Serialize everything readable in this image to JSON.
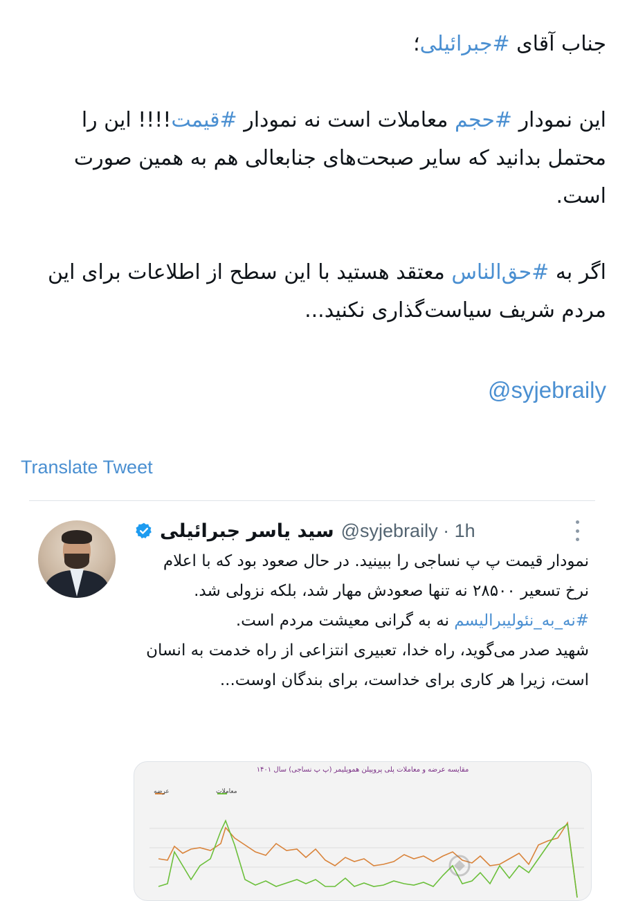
{
  "tweet": {
    "line1_pre": "جناب آقای ",
    "tag_jebraily": "#جبرائیلی",
    "line1_post": "؛",
    "para2_pre": "این نمودار ",
    "tag_hajm": "#حجم",
    "para2_mid": " معاملات است نه نمودار ",
    "tag_gheymat": "#قیمت",
    "para2_post": "!!!! این را محتمل بدانید که سایر صبحت‌های جنابعالی هم به همین صورت است.",
    "para3_pre": "اگر به ",
    "tag_haghonnas": "#حق‌الناس",
    "para3_post": " معتقد هستید با این سطح از اطلاعات برای این مردم شریف سیاست‌گذاری نکنید...",
    "mention": "@syjebraily"
  },
  "translate_label": "Translate Tweet",
  "quoted": {
    "name": "سید یاسر جبرائیلی",
    "handle_time": "@syjebraily · 1h",
    "text_pre": "نمودار قیمت پ پ نساجی را ببینید. در حال صعود بود که با اعلام نرخ تسعیر ۲۸۵۰۰ نه تنها صعودش مهار شد، بلکه نزولی شد. ",
    "tag": "#نه_به_نئولیبرالیسم",
    "text_post": " نه به گرانی معیشت مردم است.",
    "para2": "شهید صدر می‌گوید، راه خدا، تعبیری انتزاعی از راه خدمت به انسان است، زیرا هر کاری برای خداست، برای بندگان اوست..."
  },
  "media": {
    "title": "مقایسه عرضه و معاملات پلی پروپیلن هموپلیمر (پ پ نساجی) سال ۱۴۰۱",
    "legend_supply": "عرضه",
    "legend_trades": "معاملات"
  },
  "colors": {
    "hashtag": "#4a8fd1",
    "verified": "#1d9bf0",
    "supply_series": "#d9833a",
    "trades_series": "#6bbf3a"
  },
  "icons": {
    "verified": "verified-badge-icon",
    "more": "more-vertical-icon"
  }
}
